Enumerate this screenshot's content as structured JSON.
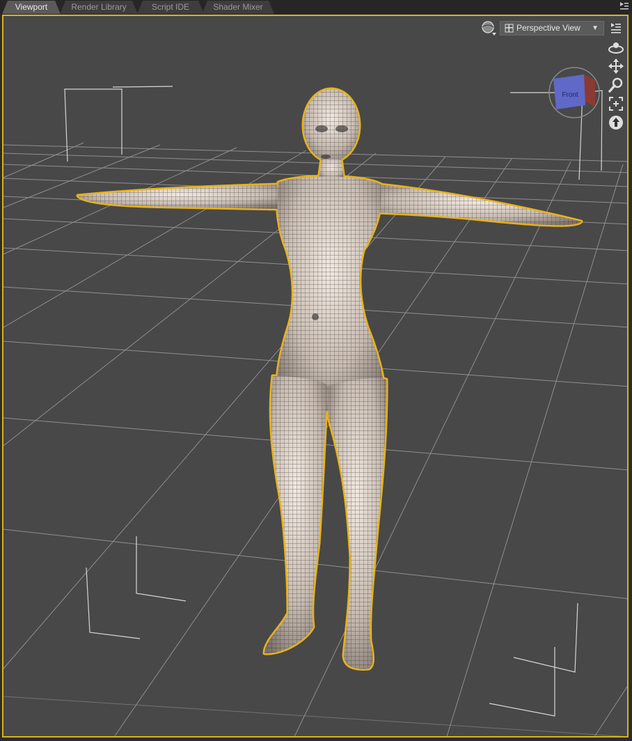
{
  "tabs": [
    {
      "label": "Viewport",
      "active": true
    },
    {
      "label": "Render Library",
      "active": false
    },
    {
      "label": "Script IDE",
      "active": false
    },
    {
      "label": "Shader Mixer",
      "active": false
    }
  ],
  "viewport": {
    "view_mode": "Perspective View",
    "view_cube_face": "Front",
    "selection_color": "#e8b31a",
    "icons": {
      "tab_menu": "panel-menu-icon",
      "draw_style": "draw-style-sphere-icon",
      "view_menu": "viewport-options-icon",
      "orbit": "orbit-icon",
      "pan": "pan-icon",
      "zoom": "zoom-icon",
      "frame": "frame-icon",
      "reset": "reset-view-icon"
    }
  }
}
